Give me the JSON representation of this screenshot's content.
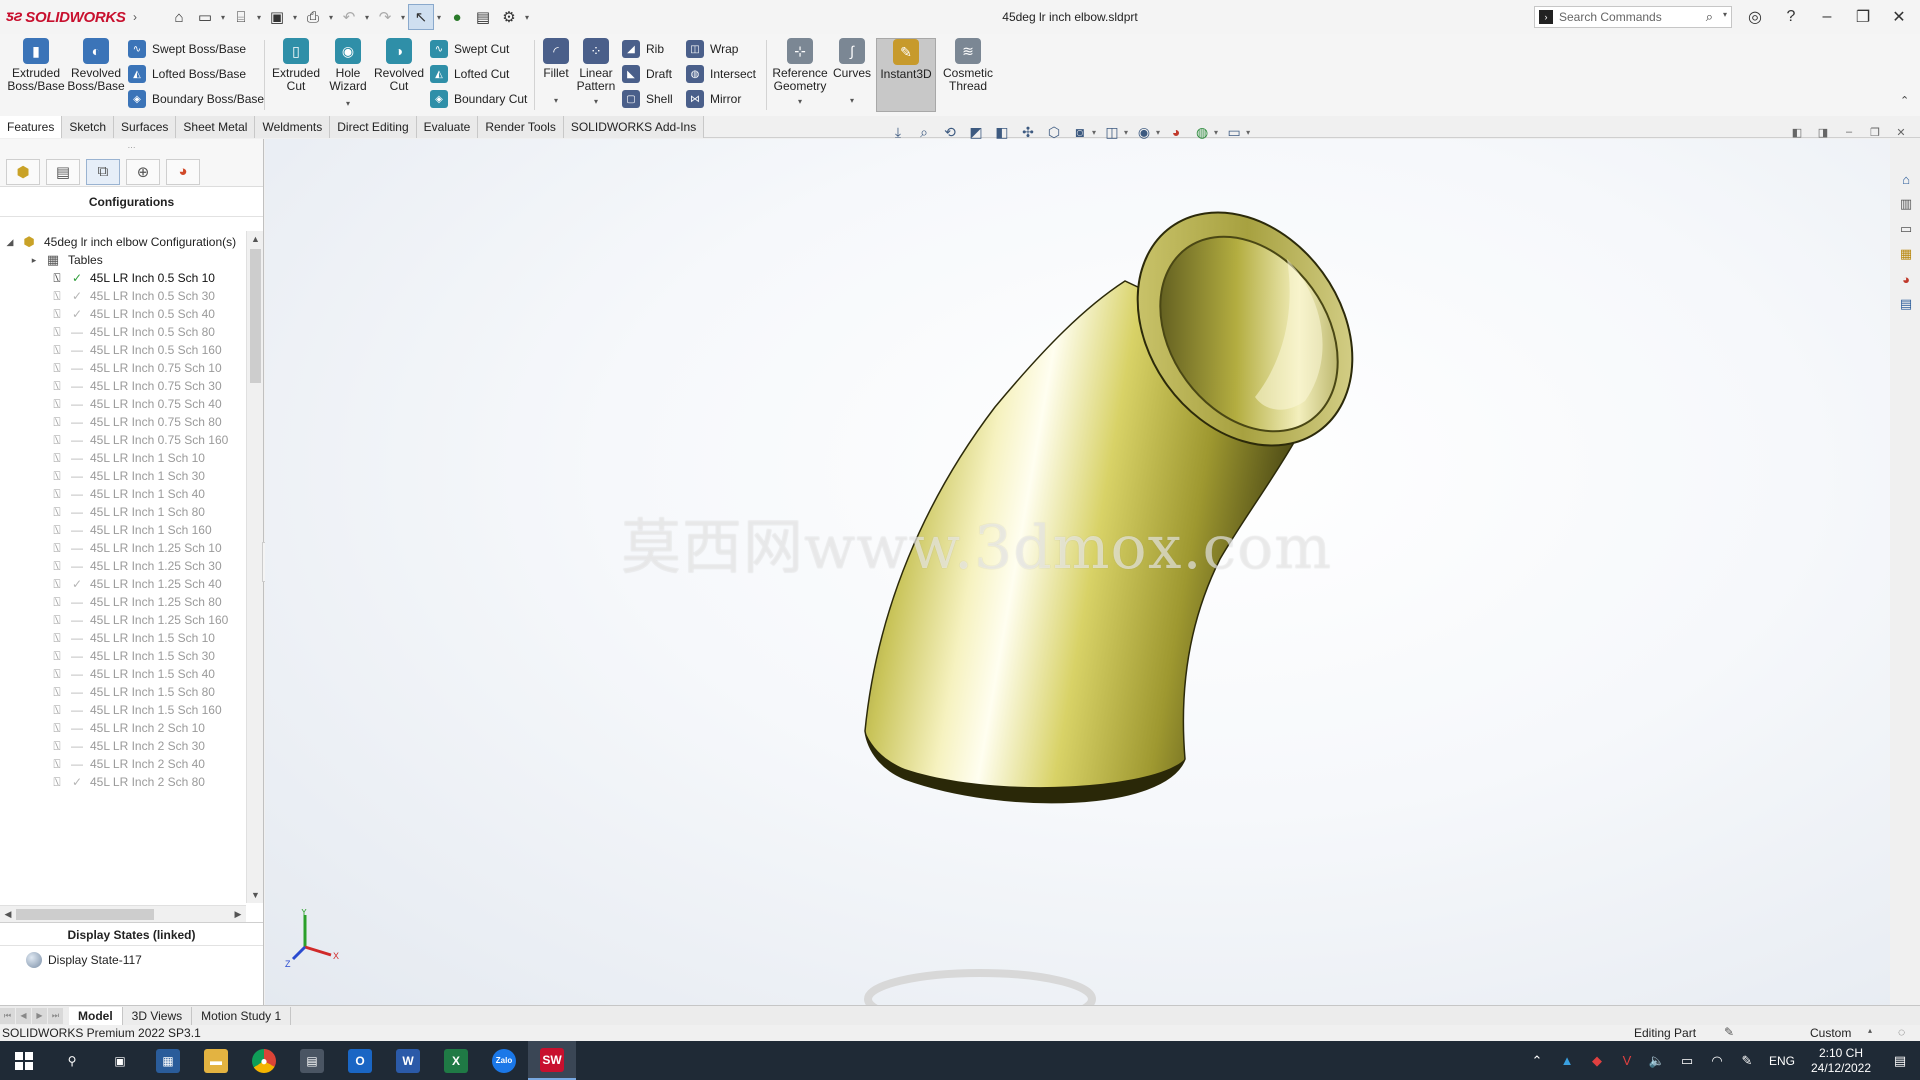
{
  "app": {
    "logo_text": "SOLIDWORKS",
    "document_title": "45deg lr inch elbow.sldprt",
    "search_placeholder": "Search Commands"
  },
  "ribbon": {
    "extruded_boss": "Extruded Boss/Base",
    "revolved_boss": "Revolved Boss/Base",
    "swept_boss": "Swept Boss/Base",
    "lofted_boss": "Lofted Boss/Base",
    "boundary_boss": "Boundary Boss/Base",
    "extruded_cut": "Extruded Cut",
    "hole_wizard": "Hole Wizard",
    "revolved_cut": "Revolved Cut",
    "swept_cut": "Swept Cut",
    "lofted_cut": "Lofted Cut",
    "boundary_cut": "Boundary Cut",
    "fillet": "Fillet",
    "linear_pattern": "Linear Pattern",
    "rib": "Rib",
    "draft": "Draft",
    "shell": "Shell",
    "wrap": "Wrap",
    "intersect": "Intersect",
    "mirror": "Mirror",
    "reference_geometry": "Reference Geometry",
    "curves": "Curves",
    "instant3d": "Instant3D",
    "cosmetic_thread": "Cosmetic Thread"
  },
  "cm_tabs": [
    "Features",
    "Sketch",
    "Surfaces",
    "Sheet Metal",
    "Weldments",
    "Direct Editing",
    "Evaluate",
    "Render Tools",
    "SOLIDWORKS Add-Ins"
  ],
  "left_panel": {
    "heading": "Configurations",
    "root": "45deg lr inch elbow Configuration(s)",
    "tables": "Tables",
    "configurations": [
      {
        "label": "45L LR Inch 0.5 Sch 10",
        "mark": "✓",
        "active": true
      },
      {
        "label": "45L LR Inch 0.5 Sch 30",
        "mark": "✓"
      },
      {
        "label": "45L LR Inch 0.5 Sch 40",
        "mark": "✓"
      },
      {
        "label": "45L LR Inch 0.5 Sch 80",
        "mark": "—"
      },
      {
        "label": "45L LR Inch 0.5 Sch 160",
        "mark": "—"
      },
      {
        "label": "45L LR Inch 0.75 Sch 10",
        "mark": "—"
      },
      {
        "label": "45L LR Inch 0.75 Sch 30",
        "mark": "—"
      },
      {
        "label": "45L LR Inch 0.75 Sch 40",
        "mark": "—"
      },
      {
        "label": "45L LR Inch 0.75 Sch 80",
        "mark": "—"
      },
      {
        "label": "45L LR Inch 0.75 Sch 160",
        "mark": "—"
      },
      {
        "label": "45L LR Inch 1 Sch 10",
        "mark": "—"
      },
      {
        "label": "45L LR Inch 1 Sch 30",
        "mark": "—"
      },
      {
        "label": "45L LR Inch 1 Sch 40",
        "mark": "—"
      },
      {
        "label": "45L LR Inch 1 Sch 80",
        "mark": "—"
      },
      {
        "label": "45L LR Inch 1 Sch 160",
        "mark": "—"
      },
      {
        "label": "45L LR Inch 1.25 Sch 10",
        "mark": "—"
      },
      {
        "label": "45L LR Inch 1.25 Sch 30",
        "mark": "—"
      },
      {
        "label": "45L LR Inch 1.25 Sch 40",
        "mark": "✓"
      },
      {
        "label": "45L LR Inch 1.25 Sch 80",
        "mark": "—"
      },
      {
        "label": "45L LR Inch 1.25 Sch 160",
        "mark": "—"
      },
      {
        "label": "45L LR Inch 1.5 Sch 10",
        "mark": "—"
      },
      {
        "label": "45L LR Inch 1.5 Sch 30",
        "mark": "—"
      },
      {
        "label": "45L LR Inch 1.5 Sch 40",
        "mark": "—"
      },
      {
        "label": "45L LR Inch 1.5 Sch 80",
        "mark": "—"
      },
      {
        "label": "45L LR Inch 1.5 Sch 160",
        "mark": "—"
      },
      {
        "label": "45L LR Inch 2 Sch 10",
        "mark": "—"
      },
      {
        "label": "45L LR Inch 2 Sch 30",
        "mark": "—"
      },
      {
        "label": "45L LR Inch 2 Sch 40",
        "mark": "—"
      },
      {
        "label": "45L LR Inch 2 Sch 80",
        "mark": "✓"
      }
    ],
    "display_states_heading": "Display States (linked)",
    "display_state": "Display State-117"
  },
  "graphics": {
    "watermark": "莫西网www.3dmox.com",
    "part_color": "#c9c45a",
    "triad": {
      "x": "X",
      "y": "Y",
      "z": "Z"
    }
  },
  "bottom_tabs": [
    "Model",
    "3D Views",
    "Motion Study 1"
  ],
  "status": {
    "product": "SOLIDWORKS Premium 2022 SP3.1",
    "mode": "Editing Part",
    "units": "Custom"
  },
  "taskbar": {
    "apps": [
      {
        "name": "search",
        "glyph": "⚲"
      },
      {
        "name": "task-view",
        "glyph": "▣"
      },
      {
        "name": "store",
        "glyph": "▦"
      },
      {
        "name": "file-explorer",
        "glyph": "▬"
      },
      {
        "name": "chrome",
        "glyph": "●"
      },
      {
        "name": "calculator",
        "glyph": "▤"
      },
      {
        "name": "outlook",
        "glyph": "O"
      },
      {
        "name": "word",
        "glyph": "W"
      },
      {
        "name": "excel",
        "glyph": "X"
      },
      {
        "name": "zalo",
        "glyph": "Zalo"
      },
      {
        "name": "solidworks",
        "glyph": "SW"
      }
    ],
    "language": "ENG",
    "time": "2:10 CH",
    "date": "24/12/2022"
  }
}
